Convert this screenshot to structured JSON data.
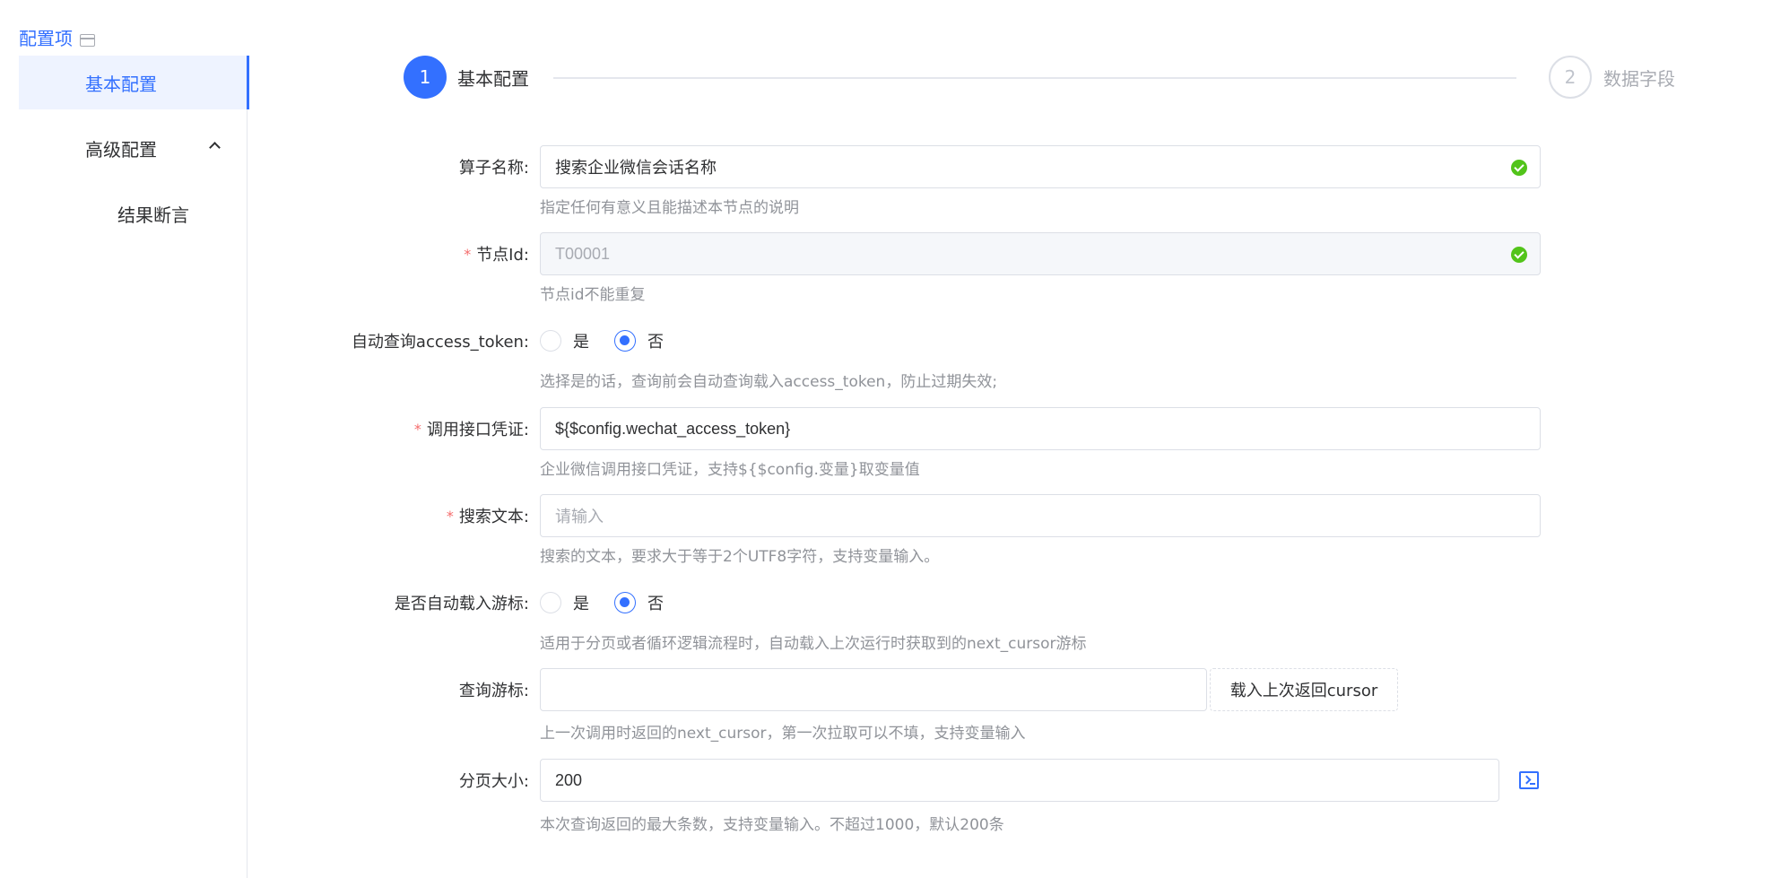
{
  "sidebar": {
    "title": "配置项",
    "items": [
      {
        "label": "基本配置"
      },
      {
        "label": "高级配置"
      },
      {
        "label": "结果断言"
      }
    ]
  },
  "steps": [
    {
      "number": "1",
      "title": "基本配置"
    },
    {
      "number": "2",
      "title": "数据字段"
    }
  ],
  "form": {
    "operator_name": {
      "label": "算子名称:",
      "value": "搜索企业微信会话名称",
      "hint": "指定任何有意义且能描述本节点的说明"
    },
    "node_id": {
      "required_mark": "*",
      "label": "节点Id:",
      "value": "T00001",
      "hint": "节点id不能重复"
    },
    "auto_token": {
      "label": "自动查询access_token:",
      "options": [
        "是",
        "否"
      ],
      "selected": "否",
      "hint": "选择是的话，查询前会自动查询载入access_token，防止过期失效;"
    },
    "credential": {
      "required_mark": "*",
      "label": "调用接口凭证:",
      "value": "${$config.wechat_access_token}",
      "hint": "企业微信调用接口凭证，支持${$config.变量}取变量值"
    },
    "search_text": {
      "required_mark": "*",
      "label": "搜索文本:",
      "placeholder": "请输入",
      "hint": "搜索的文本，要求大于等于2个UTF8字符，支持变量输入。"
    },
    "auto_cursor": {
      "label": "是否自动载入游标:",
      "options": [
        "是",
        "否"
      ],
      "selected": "否",
      "hint": "适用于分页或者循环逻辑流程时，自动载入上次运行时获取到的next_cursor游标"
    },
    "query_cursor": {
      "label": "查询游标:",
      "value": "",
      "button_label": "载入上次返回cursor",
      "hint": "上一次调用时返回的next_cursor，第一次拉取可以不填，支持变量输入"
    },
    "page_size": {
      "label": "分页大小:",
      "value": "200",
      "hint": "本次查询返回的最大条数，支持变量输入。不超过1000，默认200条"
    }
  },
  "colors": {
    "primary": "#3370ff",
    "success": "#52c41a",
    "required": "#f56c6c",
    "hint": "#909399"
  }
}
